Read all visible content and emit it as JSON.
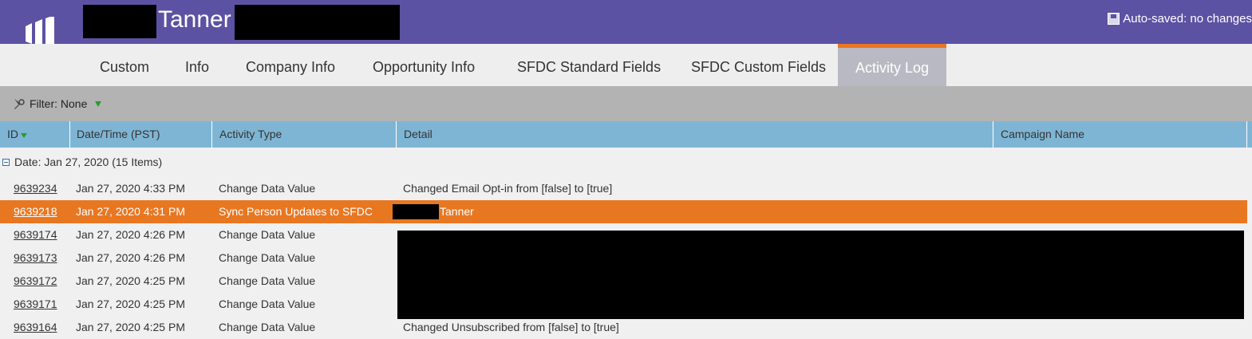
{
  "header": {
    "person_name": "Tanner",
    "autosave_text": "Auto-saved: no changes"
  },
  "icons": {
    "logo": "marketo-logo-icon",
    "autosave": "floppy-disk-icon",
    "filter": "filter-icon",
    "sort": "sort-down-icon",
    "collapse": "collapse-icon"
  },
  "tabs": [
    {
      "label": "Custom"
    },
    {
      "label": "Info"
    },
    {
      "label": "Company Info"
    },
    {
      "label": "Opportunity Info"
    },
    {
      "label": "SFDC Standard Fields"
    },
    {
      "label": "SFDC Custom Fields"
    },
    {
      "label": "Activity Log",
      "active": true
    }
  ],
  "filter": {
    "label": "Filter: None"
  },
  "table": {
    "columns": [
      "ID",
      "Date/Time (PST)",
      "Activity Type",
      "Detail",
      "Campaign Name"
    ],
    "group_label": "Date: Jan 27, 2020 (15 Items)",
    "rows": [
      {
        "id": "9639234",
        "datetime": "Jan 27, 2020 4:33 PM",
        "type": "Change Data Value",
        "detail": "Changed Email Opt-in from [false] to [true]"
      },
      {
        "id": "9639218",
        "datetime": "Jan 27, 2020 4:31 PM",
        "type": "Sync Person Updates to SFDC",
        "detail": "Tanner",
        "selected": true
      },
      {
        "id": "9639174",
        "datetime": "Jan 27, 2020 4:26 PM",
        "type": "Change Data Value",
        "detail": ""
      },
      {
        "id": "9639173",
        "datetime": "Jan 27, 2020 4:26 PM",
        "type": "Change Data Value",
        "detail": ""
      },
      {
        "id": "9639172",
        "datetime": "Jan 27, 2020 4:25 PM",
        "type": "Change Data Value",
        "detail": ""
      },
      {
        "id": "9639171",
        "datetime": "Jan 27, 2020 4:25 PM",
        "type": "Change Data Value",
        "detail": ""
      },
      {
        "id": "9639164",
        "datetime": "Jan 27, 2020 4:25 PM",
        "type": "Change Data Value",
        "detail": "Changed Unsubscribed from [false] to [true]"
      }
    ]
  },
  "colors": {
    "brand_purple": "#5c52a3",
    "accent_orange": "#e87722",
    "header_blue": "#7fb5d4"
  }
}
